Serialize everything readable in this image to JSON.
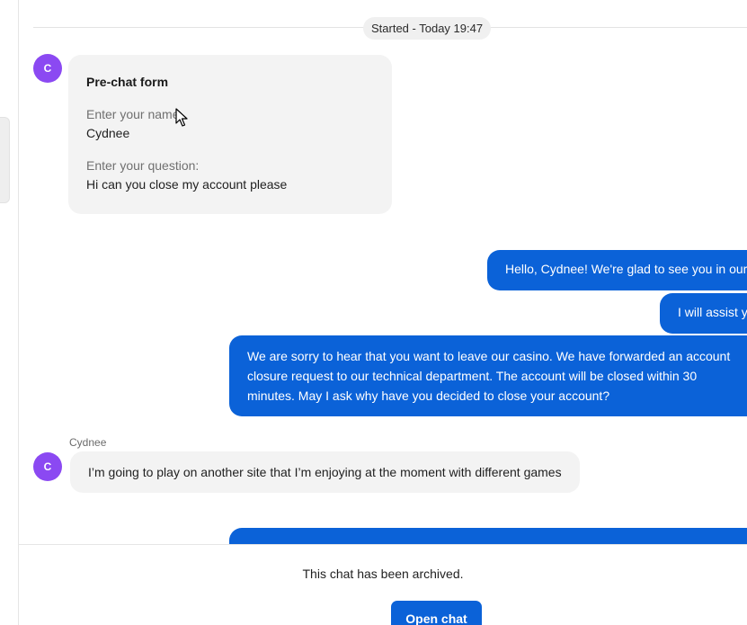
{
  "header": {
    "started_label": "Started - Today 19:47"
  },
  "prechat": {
    "avatar_initial": "C",
    "title": "Pre-chat form",
    "name_label": "Enter your name",
    "name_value": "Cydnee",
    "question_label": "Enter your question:",
    "question_value": "Hi can you close my account please"
  },
  "messages": {
    "agent_greeting": "Hello, Cydnee! We're glad to see you in our",
    "agent_assist": "I will assist you",
    "agent_closure_line1": "We are sorry to hear that you want to leave our casino. We have forwarded an account",
    "agent_closure_line2": "closure request to our technical department. The account will be closed within 30",
    "agent_closure_line3": "minutes. May I ask why have you decided to close your account?",
    "customer_name": "Cydnee",
    "customer_avatar_initial": "C",
    "customer_reply": "I’m going to play on another site that I’m enjoying at the moment with different games"
  },
  "footer": {
    "archived_text": "This chat has been archived.",
    "open_chat_label": "Open chat"
  },
  "colors": {
    "accent": "#0b62d8",
    "avatar": "#8b49f2",
    "bubble_incoming": "#f3f3f3"
  },
  "icons": {
    "cursor": "mouse-pointer-icon"
  }
}
